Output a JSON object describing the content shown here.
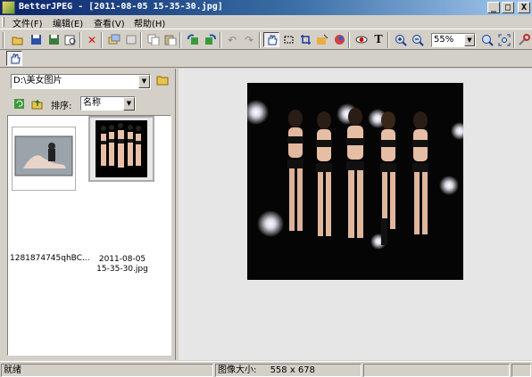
{
  "window": {
    "title": "BetterJPEG - [2011-08-05 15-35-30.jpg]",
    "buttons": {
      "minimize": "_",
      "maximize": "□",
      "close": "X"
    }
  },
  "menu": {
    "items": [
      "文件(F)",
      "编辑(E)",
      "查看(V)",
      "帮助(H)"
    ]
  },
  "toolbar": {
    "icons": [
      "open-icon",
      "save-icon",
      "save-as-icon",
      "print-preview-icon",
      "delete-icon",
      "batch-icon",
      "copy-settings-icon",
      "copy-icon",
      "paste-icon",
      "rotate-left-icon",
      "rotate-right-icon",
      "undo-icon",
      "redo-icon",
      "hand-tool-icon",
      "select-tool-icon",
      "crop-icon",
      "enhance-icon",
      "color-icon",
      "red-eye-icon",
      "text-icon",
      "zoom-in-icon",
      "zoom-out-icon",
      "zoom-fit-icon",
      "fit-window-icon",
      "settings-icon"
    ],
    "zoom": {
      "value": "55%"
    }
  },
  "toolbar2": {
    "icons": [
      "hand-tool-icon"
    ]
  },
  "browser": {
    "path": "D:\\美女图片",
    "sort_label": "排序:",
    "sort_value": "名称",
    "files": [
      {
        "name_line1": "1281874745qhBC...",
        "name_line2": "",
        "selected": false
      },
      {
        "name_line1": "2011-08-05",
        "name_line2": "15-35-30.jpg",
        "selected": true
      }
    ]
  },
  "status": {
    "ready": "就绪",
    "image_size_label": "图像大小:",
    "image_size_value": "558 x 678"
  }
}
